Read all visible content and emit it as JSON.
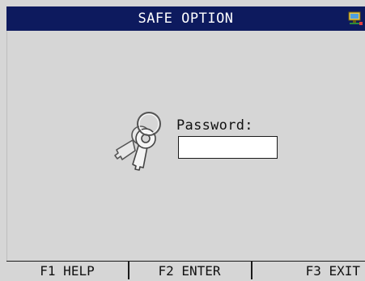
{
  "titlebar": {
    "title": "SAFE OPTION",
    "icon": "network-computer-icon",
    "background": "#0d1a5e"
  },
  "main": {
    "icon": "keys-icon",
    "password_label": "Password:",
    "password_value": ""
  },
  "function_keys": [
    {
      "label": "F1 HELP"
    },
    {
      "label": "F2 ENTER"
    },
    {
      "label": "F3 EXIT"
    }
  ]
}
